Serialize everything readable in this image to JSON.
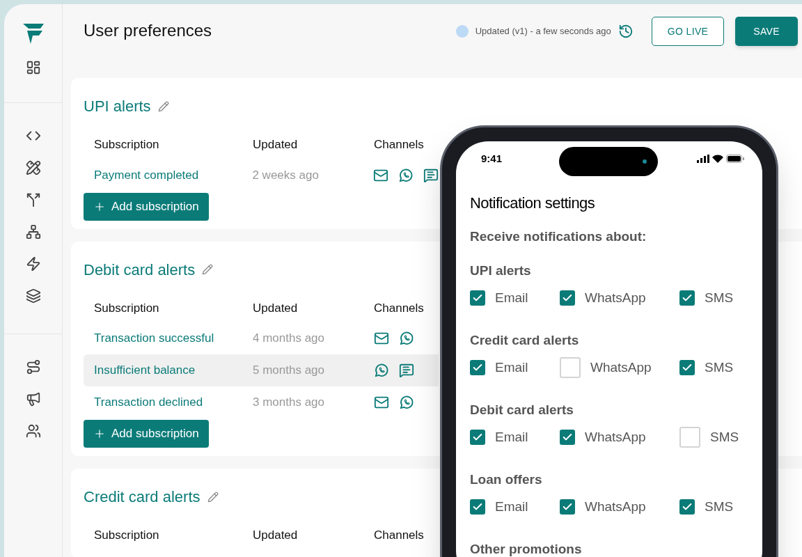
{
  "header": {
    "title": "User preferences",
    "status": "Updated (v1) - a few seconds ago",
    "buttons": [
      {
        "kind": "outline",
        "label": "GO LIVE"
      },
      {
        "kind": "filled",
        "label": "SAVE"
      }
    ]
  },
  "sections": [
    {
      "title": "UPI alerts",
      "columns": [
        "Subscription",
        "Updated",
        "Channels"
      ],
      "rows": [
        {
          "name": "Payment completed",
          "updated": "2 weeks ago",
          "channels": [
            {
              "kind": "email"
            },
            {
              "kind": "whatsapp"
            },
            {
              "kind": "sms"
            }
          ],
          "selected": false
        }
      ],
      "add_button": "Add subscription"
    },
    {
      "title": "Debit card alerts",
      "columns": [
        "Subscription",
        "Updated",
        "Channels"
      ],
      "rows": [
        {
          "name": "Transaction successful",
          "updated": "4 months ago",
          "channels": [
            {
              "kind": "email"
            },
            {
              "kind": "whatsapp"
            }
          ],
          "selected": false
        },
        {
          "name": "Insufficient balance",
          "updated": "5 months ago",
          "channels": [
            {
              "kind": "whatsapp"
            },
            {
              "kind": "sms"
            }
          ],
          "selected": true
        },
        {
          "name": "Transaction declined",
          "updated": "3 months ago",
          "channels": [
            {
              "kind": "email"
            },
            {
              "kind": "whatsapp"
            }
          ],
          "selected": false
        }
      ],
      "add_button": "Add subscription"
    },
    {
      "title": "Credit card alerts",
      "columns": [
        "Subscription",
        "Updated",
        "Channels"
      ]
    }
  ],
  "phone": {
    "time": "9:41",
    "title": "Notification settings",
    "subtitle": "Receive notifications about:",
    "groups": [
      {
        "title": "UPI alerts",
        "options": [
          {
            "label": "Email",
            "checked": true
          },
          {
            "label": "WhatsApp",
            "checked": true
          },
          {
            "label": "SMS",
            "checked": true
          }
        ]
      },
      {
        "title": "Credit card alerts",
        "options": [
          {
            "label": "Email",
            "checked": true
          },
          {
            "label": "WhatsApp",
            "checked": false
          },
          {
            "label": "SMS",
            "checked": true
          }
        ]
      },
      {
        "title": "Debit card alerts",
        "options": [
          {
            "label": "Email",
            "checked": true
          },
          {
            "label": "WhatsApp",
            "checked": true
          },
          {
            "label": "SMS",
            "checked": false
          }
        ]
      },
      {
        "title": "Loan offers",
        "options": [
          {
            "label": "Email",
            "checked": true
          },
          {
            "label": "WhatsApp",
            "checked": true
          },
          {
            "label": "SMS",
            "checked": true
          }
        ]
      },
      {
        "title": "Other promotions"
      }
    ]
  }
}
